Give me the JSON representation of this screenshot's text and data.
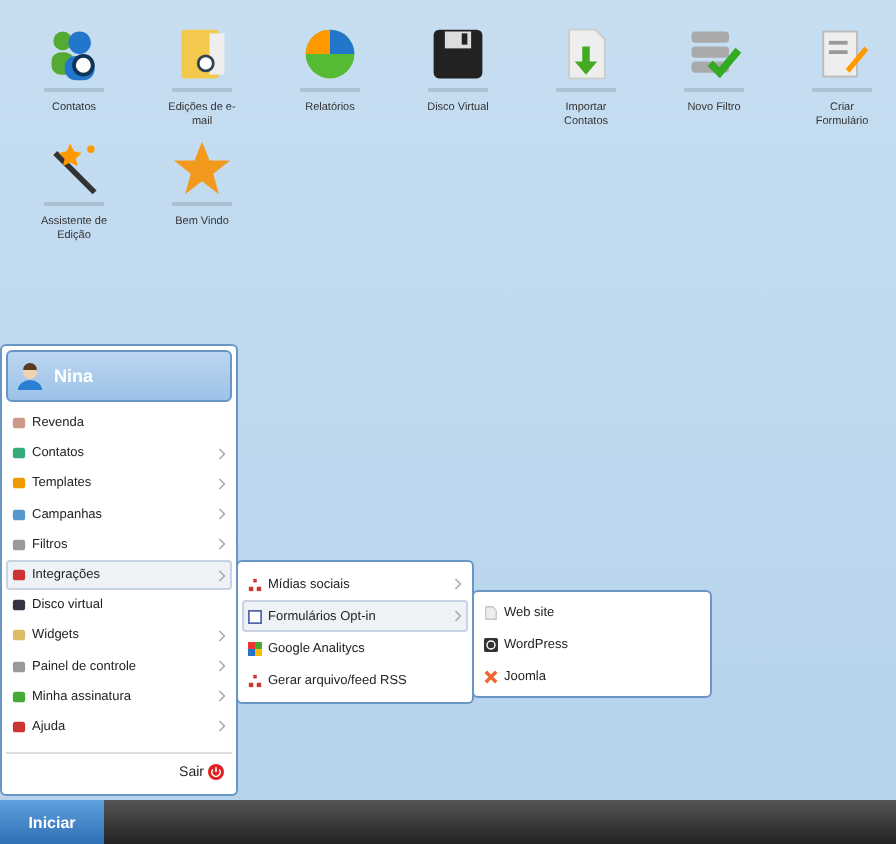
{
  "desktop_icons": [
    {
      "label": "Contatos"
    },
    {
      "label": "Edições de e-mail"
    },
    {
      "label": "Relatórios"
    },
    {
      "label": "Disco Virtual"
    },
    {
      "label": "Importar Contatos"
    },
    {
      "label": "Novo Filtro"
    },
    {
      "label": "Criar Formulário"
    },
    {
      "label": "Assistente de Edição"
    },
    {
      "label": "Bem Vindo"
    }
  ],
  "start_menu": {
    "user": "Nina",
    "items": [
      {
        "label": "Revenda",
        "submenu": false,
        "selected": false
      },
      {
        "label": "Contatos",
        "submenu": true,
        "selected": false
      },
      {
        "label": "Templates",
        "submenu": true,
        "selected": false
      },
      {
        "label": "Campanhas",
        "submenu": true,
        "selected": false
      },
      {
        "label": "Filtros",
        "submenu": true,
        "selected": false
      },
      {
        "label": "Integrações",
        "submenu": true,
        "selected": true
      },
      {
        "label": "Disco virtual",
        "submenu": false,
        "selected": false
      },
      {
        "label": "Widgets",
        "submenu": true,
        "selected": false
      },
      {
        "label": "Painel de controle",
        "submenu": true,
        "selected": false
      },
      {
        "label": "Minha assinatura",
        "submenu": true,
        "selected": false
      },
      {
        "label": "Ajuda",
        "submenu": true,
        "selected": false
      }
    ],
    "logout": "Sair"
  },
  "submenu": {
    "items": [
      {
        "label": "Mídias sociais",
        "submenu": true,
        "selected": false
      },
      {
        "label": "Formulários Opt-in",
        "submenu": true,
        "selected": true
      },
      {
        "label": "Google Analitycs",
        "submenu": false,
        "selected": false
      },
      {
        "label": "Gerar arquivo/feed RSS",
        "submenu": false,
        "selected": false
      }
    ]
  },
  "submenu_2": {
    "items": [
      {
        "label": "Web site",
        "submenu": false,
        "selected": false
      },
      {
        "label": "WordPress",
        "submenu": false,
        "selected": false
      },
      {
        "label": "Joomla",
        "submenu": false,
        "selected": false
      }
    ]
  },
  "taskbar": {
    "start_button": "Iniciar"
  }
}
